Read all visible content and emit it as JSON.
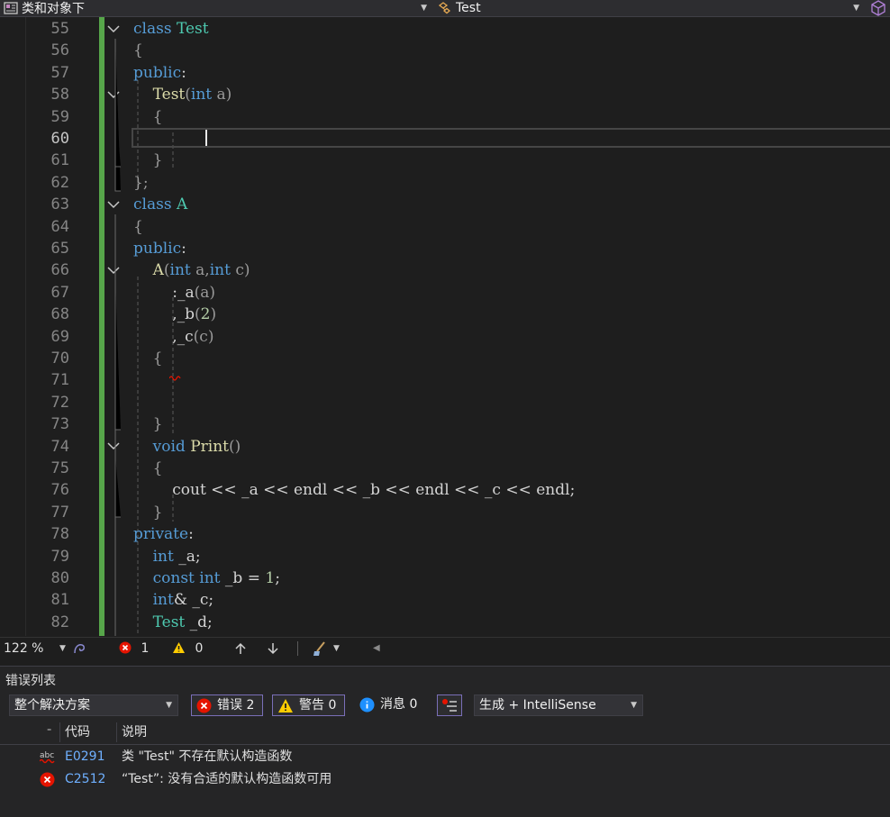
{
  "navbar": {
    "scope_dropdown": "类和对象下",
    "member_dropdown": "Test"
  },
  "editor": {
    "line_numbers": [
      "55",
      "56",
      "57",
      "58",
      "59",
      "60",
      "61",
      "62",
      "63",
      "64",
      "65",
      "66",
      "67",
      "68",
      "69",
      "70",
      "71",
      "72",
      "73",
      "74",
      "75",
      "76",
      "77",
      "78",
      "79",
      "80",
      "81",
      "82"
    ],
    "current_line": "60"
  },
  "status_bar": {
    "zoom": "122 %",
    "error_count": "1",
    "warning_count": "0"
  },
  "error_list": {
    "title": "错误列表",
    "scope": "整个解决方案",
    "errors_button": "错误 2",
    "warnings_button": "警告 0",
    "messages_button": "消息 0",
    "source": "生成 + IntelliSense",
    "columns": {
      "code": "代码",
      "description": "说明"
    },
    "rows": [
      {
        "code": "E0291",
        "description": "类 \"Test\" 不存在默认构造函数"
      },
      {
        "code": "C2512",
        "description": "“Test”: 没有合适的默认构造函数可用"
      }
    ]
  },
  "colors": {
    "keyword": "#569cd6",
    "type": "#4ec9b0",
    "function": "#dcdcaa",
    "variable": "#9cdcfe",
    "change_bar": "#57a64a",
    "error": "#e51400"
  }
}
